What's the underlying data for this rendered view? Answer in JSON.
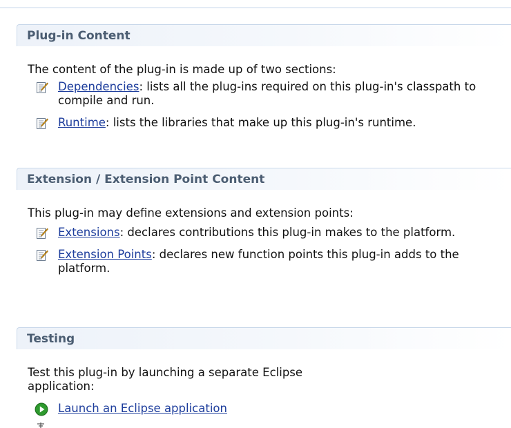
{
  "sections": [
    {
      "title": "Plug-in Content",
      "intro": "The content of the plug-in is made up of two sections:",
      "items": [
        {
          "link": "Dependencies",
          "text": ": lists all the plug-ins required on this plug-in's classpath to compile and run.",
          "icon": "page-edit-icon"
        },
        {
          "link": "Runtime",
          "text": ": lists the libraries that make up this plug-in's runtime.",
          "icon": "page-edit-icon"
        }
      ]
    },
    {
      "title": "Extension / Extension Point Content",
      "intro": "This plug-in may define extensions and extension points:",
      "items": [
        {
          "link": "Extensions",
          "text": ": declares contributions this plug-in makes to the platform.",
          "icon": "page-edit-icon"
        },
        {
          "link": "Extension Points",
          "text": ": declares new function points this plug-in adds to the platform.",
          "icon": "page-edit-icon"
        }
      ]
    },
    {
      "title": "Testing",
      "intro": "Test this plug-in by launching a separate Eclipse application:",
      "items": [
        {
          "link": "Launch an Eclipse application",
          "text": "",
          "icon": "run-icon"
        }
      ]
    }
  ],
  "colors": {
    "link": "#1d3d9c",
    "header_text": "#4b5d72",
    "header_border": "#c9d8ea",
    "run_icon": "#2e9a2e"
  }
}
